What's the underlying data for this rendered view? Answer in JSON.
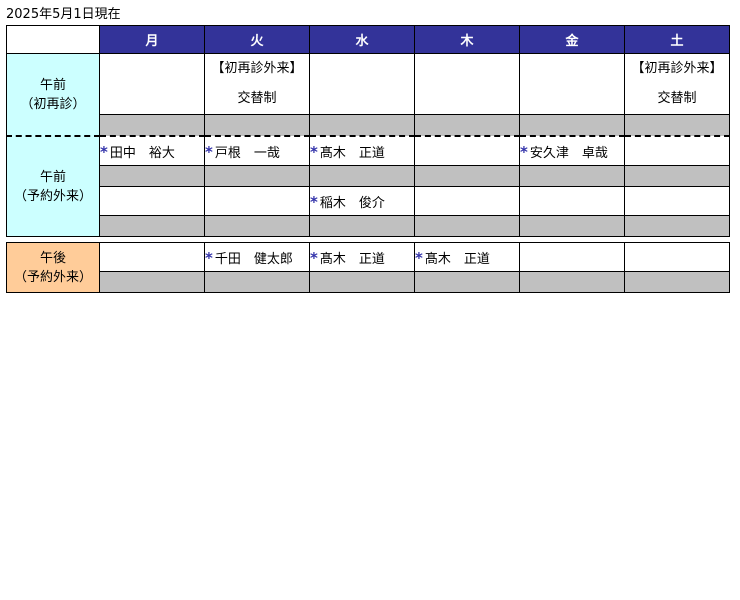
{
  "as_of": "2025年5月1日現在",
  "days": [
    "月",
    "火",
    "水",
    "木",
    "金",
    "土"
  ],
  "am_first": {
    "label_line1": "午前",
    "label_line2": "（初再診）",
    "cells": [
      {
        "line1": "",
        "line2": ""
      },
      {
        "line1": "【初再診外来】",
        "line2": "交替制"
      },
      {
        "line1": "",
        "line2": ""
      },
      {
        "line1": "",
        "line2": ""
      },
      {
        "line1": "",
        "line2": ""
      },
      {
        "line1": "【初再診外来】",
        "line2": "交替制"
      }
    ]
  },
  "am_reserved": {
    "label_line1": "午前",
    "label_line2": "（予約外来）",
    "row1": [
      "田中　裕大",
      "戸根　一哉",
      "髙木　正道",
      "",
      "安久津　卓哉",
      ""
    ],
    "row2": [
      "",
      "",
      "稲木　俊介",
      "",
      "",
      ""
    ]
  },
  "pm_reserved": {
    "label_line1": "午後",
    "label_line2": "（予約外来）",
    "row1": [
      "",
      "千田　健太郎",
      "髙木　正道",
      "髙木　正道",
      "",
      ""
    ]
  },
  "star_symbol": "*",
  "colors": {
    "header_bg": "#333399",
    "am_label_bg": "#ccffff",
    "pm_label_bg": "#ffcc99",
    "gray_row": "#c0c0c0",
    "star": "#3333aa"
  }
}
